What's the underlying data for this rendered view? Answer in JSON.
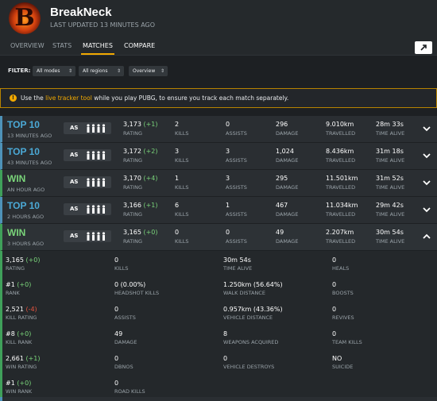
{
  "profile": {
    "logo_letter": "B",
    "username": "BreakNeck",
    "last_updated": "LAST UPDATED 13 MINUTES AGO"
  },
  "tabs": [
    {
      "label": "OVERVIEW"
    },
    {
      "label": "STATS"
    },
    {
      "label": "MATCHES"
    },
    {
      "label": "COMPARE"
    }
  ],
  "filters": {
    "label": "FILTER:",
    "mode": "All modes",
    "region": "All regions",
    "view": "Overview"
  },
  "notice": {
    "before": "Use the ",
    "link": "live tracker tool",
    "after": " while you play PUBG, to ensure you track each match separately."
  },
  "matches": [
    {
      "place": "TOP 10",
      "when": "13 MINUTES AGO",
      "mode": "AS",
      "rating": "3,173",
      "rating_delta": "(+1)",
      "kills": "2",
      "assists": "0",
      "damage": "296",
      "travelled": "9.010km",
      "time_alive": "28m 33s"
    },
    {
      "place": "TOP 10",
      "when": "43 MINUTES AGO",
      "mode": "AS",
      "rating": "3,172",
      "rating_delta": "(+2)",
      "kills": "3",
      "assists": "3",
      "damage": "1,024",
      "travelled": "8.436km",
      "time_alive": "31m 18s"
    },
    {
      "place": "WIN",
      "when": "AN HOUR AGO",
      "mode": "AS",
      "rating": "3,170",
      "rating_delta": "(+4)",
      "kills": "1",
      "assists": "3",
      "damage": "295",
      "travelled": "11.501km",
      "time_alive": "31m 52s"
    },
    {
      "place": "TOP 10",
      "when": "2 HOURS AGO",
      "mode": "AS",
      "rating": "3,166",
      "rating_delta": "(+1)",
      "kills": "6",
      "assists": "1",
      "damage": "467",
      "travelled": "11.034km",
      "time_alive": "29m 42s"
    },
    {
      "place": "WIN",
      "when": "3 HOURS AGO",
      "mode": "AS",
      "rating": "3,165",
      "rating_delta": "(+0)",
      "kills": "0",
      "assists": "0",
      "damage": "49",
      "travelled": "2.207km",
      "time_alive": "30m 54s"
    }
  ],
  "labels": {
    "rating": "RATING",
    "kills": "KILLS",
    "assists": "ASSISTS",
    "damage": "DAMAGE",
    "travelled": "TRAVELLED",
    "time_alive": "TIME ALIVE"
  },
  "detail": {
    "rating_val": "3,165",
    "rating_delta": "(+0)",
    "rating_lbl": "RATING",
    "kills_val": "0",
    "kills_lbl": "KILLS",
    "time_alive_val": "30m 54s",
    "time_alive_lbl": "TIME ALIVE",
    "heals_val": "0",
    "heals_lbl": "HEALS",
    "rank_val": "#1",
    "rank_delta": "(+0)",
    "rank_lbl": "RANK",
    "headshot_val": "0 (0.00%)",
    "headshot_lbl": "HEADSHOT KILLS",
    "walk_val": "1.250km (56.64%)",
    "walk_lbl": "WALK DISTANCE",
    "boosts_val": "0",
    "boosts_lbl": "BOOSTS",
    "kill_rating_val": "2,521",
    "kill_rating_delta": "(-4)",
    "kill_rating_lbl": "KILL RATING",
    "assists_val": "0",
    "assists_lbl": "ASSISTS",
    "vehicle_dist_val": "0.957km (43.36%)",
    "vehicle_dist_lbl": "VEHICLE DISTANCE",
    "revives_val": "0",
    "revives_lbl": "REVIVES",
    "kill_rank_val": "#8",
    "kill_rank_delta": "(+0)",
    "kill_rank_lbl": "KILL RANK",
    "damage_val": "49",
    "damage_lbl": "DAMAGE",
    "weapons_val": "8",
    "weapons_lbl": "WEAPONS ACQUIRED",
    "team_kills_val": "0",
    "team_kills_lbl": "TEAM KILLS",
    "win_rating_val": "2,661",
    "win_rating_delta": "(+1)",
    "win_rating_lbl": "WIN RATING",
    "dbnos_val": "0",
    "dbnos_lbl": "DBNOS",
    "vehicle_destroys_val": "0",
    "vehicle_destroys_lbl": "VEHICLE DESTROYS",
    "suicide_val": "NO",
    "suicide_lbl": "SUICIDE",
    "win_rank_val": "#1",
    "win_rank_delta": "(+0)",
    "win_rank_lbl": "WIN RANK",
    "road_kills_val": "0",
    "road_kills_lbl": "ROAD KILLS"
  },
  "colors": {
    "accent": "#f2a900",
    "top10": "#4ba9d6",
    "win": "#7ad57a",
    "negative": "#e4533f"
  },
  "icons": [
    "squad-icon",
    "chevron-down-icon",
    "chevron-up-icon",
    "share-icon",
    "info-icon"
  ]
}
